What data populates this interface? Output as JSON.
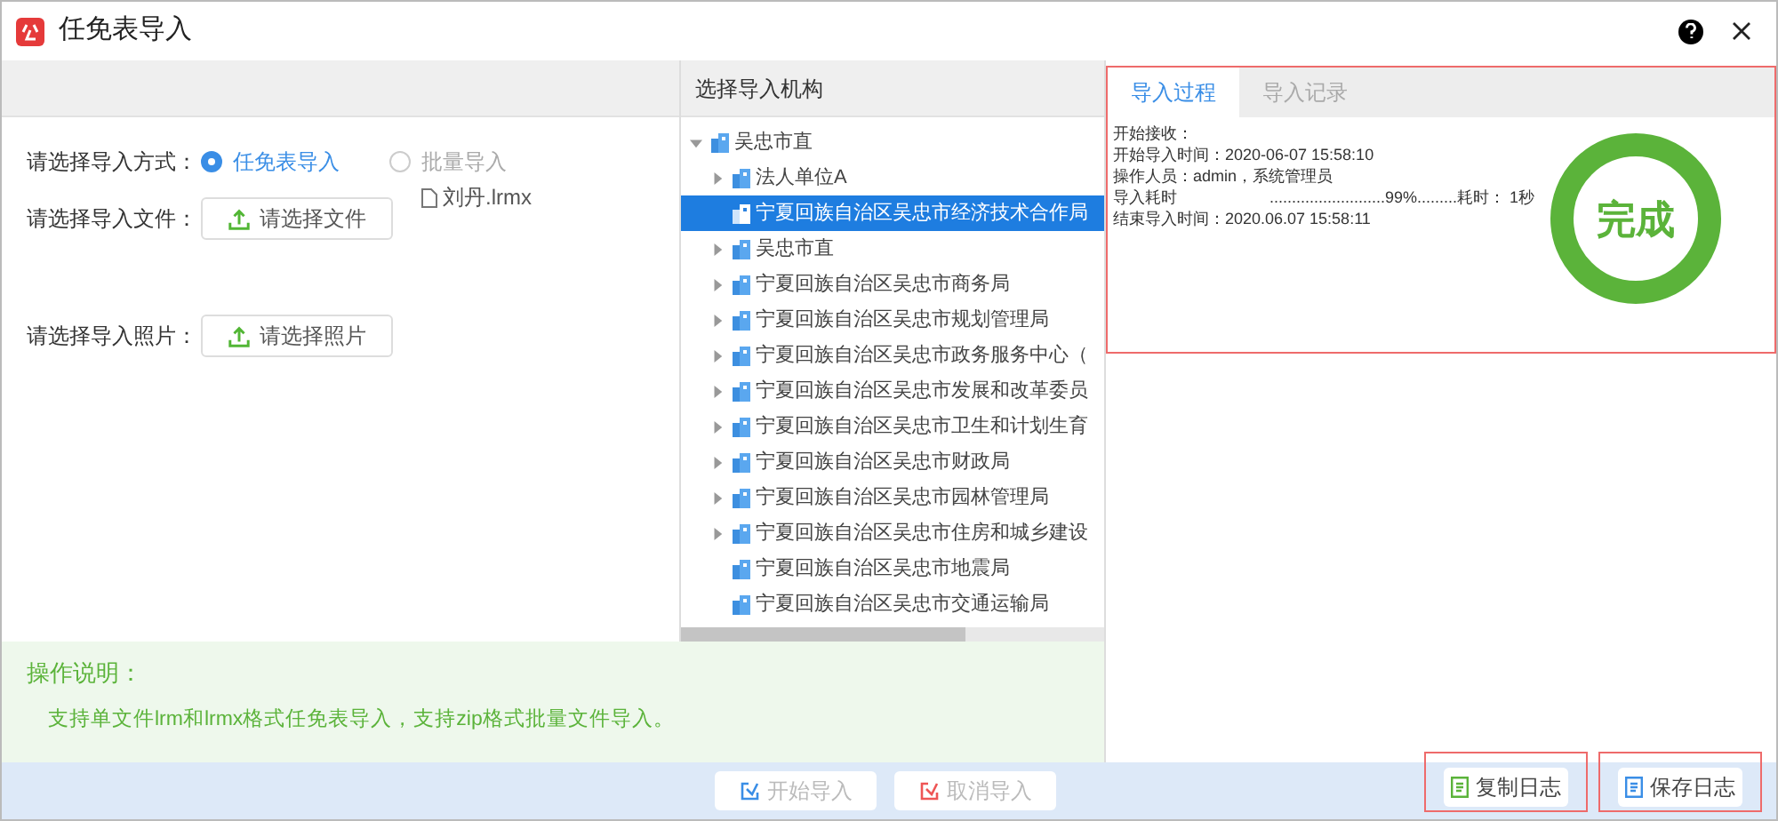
{
  "window": {
    "title": "任免表导入"
  },
  "import_form": {
    "method_label": "请选择导入方式：",
    "methods": [
      {
        "label": "任免表导入",
        "selected": true
      },
      {
        "label": "批量导入",
        "selected": false
      }
    ],
    "drag_file": "刘丹.lrmx",
    "file_label": "请选择导入文件：",
    "file_button": "请选择文件",
    "photo_label": "请选择导入照片：",
    "photo_button": "请选择照片"
  },
  "tree": {
    "header": "选择导入机构",
    "nodes": [
      {
        "label": "吴忠市直",
        "expanded": true,
        "selected": false,
        "children": [
          {
            "label": "法人单位A",
            "expandable": true,
            "selected": false
          },
          {
            "label": "宁夏回族自治区吴忠市经济技术合作局",
            "expandable": false,
            "selected": true
          },
          {
            "label": "吴忠市直",
            "expandable": true,
            "selected": false
          },
          {
            "label": "宁夏回族自治区吴忠市商务局",
            "expandable": true,
            "selected": false
          },
          {
            "label": "宁夏回族自治区吴忠市规划管理局",
            "expandable": true,
            "selected": false
          },
          {
            "label": "宁夏回族自治区吴忠市政务服务中心（",
            "expandable": true,
            "selected": false
          },
          {
            "label": "宁夏回族自治区吴忠市发展和改革委员",
            "expandable": true,
            "selected": false
          },
          {
            "label": "宁夏回族自治区吴忠市卫生和计划生育",
            "expandable": true,
            "selected": false
          },
          {
            "label": "宁夏回族自治区吴忠市财政局",
            "expandable": true,
            "selected": false
          },
          {
            "label": "宁夏回族自治区吴忠市园林管理局",
            "expandable": true,
            "selected": false
          },
          {
            "label": "宁夏回族自治区吴忠市住房和城乡建设",
            "expandable": true,
            "selected": false
          },
          {
            "label": "宁夏回族自治区吴忠市地震局",
            "expandable": false,
            "selected": false
          },
          {
            "label": "宁夏回族自治区吴忠市交通运输局",
            "expandable": false,
            "selected": false
          }
        ]
      }
    ]
  },
  "notes": {
    "title": "操作说明：",
    "text": "支持单文件lrm和lrmx格式任免表导入，支持zip格式批量文件导入。"
  },
  "actions": [
    {
      "label": "开始导入",
      "kind": "start",
      "disabled": true
    },
    {
      "label": "取消导入",
      "kind": "cancel",
      "disabled": true
    }
  ],
  "log_panel": {
    "highlighted": true,
    "tabs": [
      {
        "label": "导入过程",
        "selected": true
      },
      {
        "label": "导入记录",
        "selected": false
      }
    ],
    "lines": [
      {
        "text": "开始接收："
      },
      {
        "text": "开始导入时间：2020-06-07 15:58:10"
      },
      {
        "text": "操作人员：admin，系统管理员"
      },
      {
        "text": "导入耗时",
        "progress": "..........................99%.........耗时： 1秒"
      },
      {
        "text": "结束导入时间：2020.06.07 15:58:11"
      }
    ],
    "status": "完成"
  },
  "log_buttons": [
    {
      "label": "复制日志",
      "kind": "copy",
      "highlighted": true
    },
    {
      "label": "保存日志",
      "kind": "save",
      "highlighted": true
    }
  ]
}
